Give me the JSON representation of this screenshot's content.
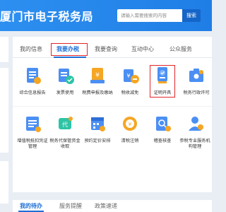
{
  "header": {
    "title": "厦门市电子税务局",
    "search_placeholder": "请输入需要搜索的内容",
    "search_button": "搜索"
  },
  "tabs": [
    {
      "label": "我的信息",
      "active": false
    },
    {
      "label": "我要办税",
      "active": true
    },
    {
      "label": "我要查询",
      "active": false
    },
    {
      "label": "互动中心",
      "active": false
    },
    {
      "label": "公众服务",
      "active": false
    }
  ],
  "grid_row1": [
    {
      "label": "综合信息报告",
      "icon": "report-icon"
    },
    {
      "label": "发票使用",
      "icon": "invoice-icon"
    },
    {
      "label": "税费申报及缴纳",
      "icon": "tax-payment-icon"
    },
    {
      "label": "税收减免",
      "icon": "tax-reduction-icon"
    },
    {
      "label": "证明开具",
      "icon": "certificate-icon",
      "highlighted": true
    },
    {
      "label": "税务行政许可",
      "icon": "admin-permit-icon"
    }
  ],
  "grid_row2": [
    {
      "label": "增值税抵扣凭证",
      "label2": "管理",
      "icon": "vat-deduction-icon"
    },
    {
      "label": "税务代保管资金",
      "label2": "收取",
      "icon": "custody-fund-icon"
    },
    {
      "label": "预约定价安排",
      "label2": "",
      "icon": "pricing-arrangement-icon"
    },
    {
      "label": "清税注销",
      "label2": "",
      "icon": "tax-clearance-icon"
    },
    {
      "label": "稽查核查",
      "label2": "",
      "icon": "inspection-icon"
    },
    {
      "label": "参税专业服务机",
      "label2": "构管理",
      "icon": "service-agency-icon"
    }
  ],
  "bottom_tabs": [
    {
      "label": "我的待办",
      "active": true
    },
    {
      "label": "服务提醒",
      "active": false
    },
    {
      "label": "政策速递",
      "active": false
    }
  ],
  "colors": {
    "header_blue": "#2d8ff0",
    "accent_blue": "#1f6fd6",
    "highlight_red": "#e0262a"
  }
}
